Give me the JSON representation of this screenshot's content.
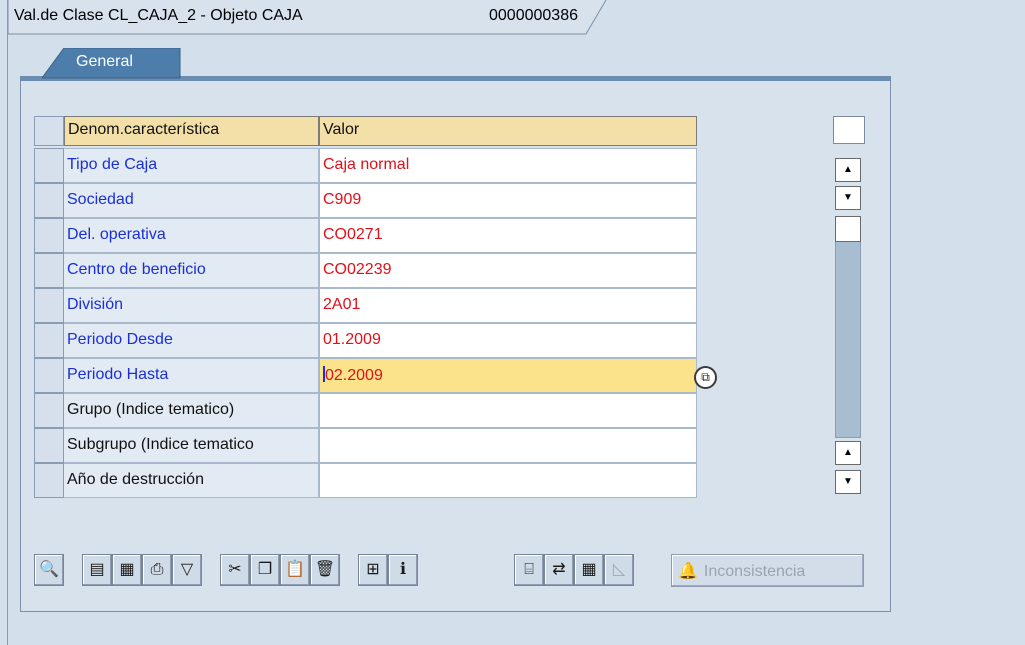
{
  "window": {
    "title": "Val.de Clase CL_CAJA_2 - Objeto CAJA",
    "object_number": "0000000386"
  },
  "tabs": [
    {
      "label": "General",
      "active": true
    }
  ],
  "table": {
    "headers": [
      "Denom.característica",
      "Valor"
    ],
    "rows": [
      {
        "name": "Tipo de Caja",
        "value": "Caja normal"
      },
      {
        "name": "Sociedad",
        "value": "C909"
      },
      {
        "name": "Del. operativa",
        "value": "CO0271"
      },
      {
        "name": "Centro de beneficio",
        "value": "CO02239"
      },
      {
        "name": "División",
        "value": "2A01"
      },
      {
        "name": "Periodo Desde",
        "value": "01.2009"
      },
      {
        "name": "Periodo Hasta",
        "value": "02.2009"
      },
      {
        "name": "Grupo (Indice tematico)",
        "value": ""
      },
      {
        "name": "Subgrupo (Indice tematico",
        "value": ""
      },
      {
        "name": "Año de destrucción",
        "value": ""
      }
    ]
  },
  "toolbar": {
    "inconsistency_label": "Inconsistencia",
    "icons": [
      "details-icon",
      "select-all-icon",
      "deselect-all-icon",
      "print-icon",
      "filter-icon",
      "cut-icon",
      "copy-icon",
      "paste-icon",
      "delete-icon",
      "insert-icon",
      "info-icon",
      "find-icon",
      "compare-icon",
      "table-settings-icon",
      "chart-icon"
    ]
  },
  "colors": {
    "background": "#d3dfea",
    "header_cell": "#f3e0a8",
    "active_cell": "#fbe38c",
    "label_text": "#1b2fd6",
    "value_text": "#e0101a",
    "tab_active": "#4d7dab"
  }
}
